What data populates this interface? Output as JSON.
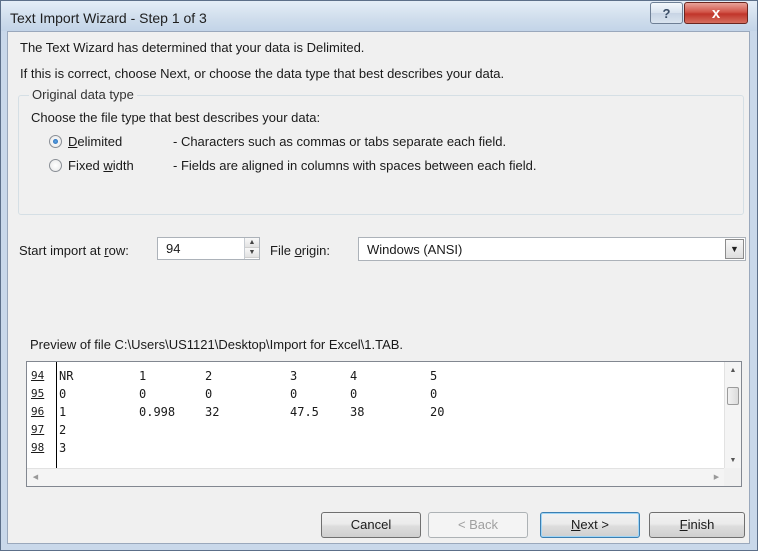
{
  "window": {
    "title": "Text Import Wizard - Step 1 of 3",
    "help_glyph": "?",
    "close_glyph": "x"
  },
  "intro": {
    "line1": "The Text Wizard has determined that your data is Delimited.",
    "line2": "If this is correct, choose Next, or choose the data type that best describes your data."
  },
  "original_data_type": {
    "legend": "Original data type",
    "prompt": "Choose the file type that best describes your data:",
    "options": [
      {
        "label_pre": "",
        "label_key": "D",
        "label_post": "elimited",
        "description": "- Characters such as commas or tabs separate each field.",
        "selected": true
      },
      {
        "label_pre": "Fixed ",
        "label_key": "w",
        "label_post": "idth",
        "description": "- Fields are aligned in columns with spaces between each field.",
        "selected": false
      }
    ]
  },
  "start_row": {
    "label_pre": "Start import at ",
    "label_key": "r",
    "label_post": "ow:",
    "value": "94"
  },
  "file_origin": {
    "label_pre": "File ",
    "label_key": "o",
    "label_post": "rigin:",
    "value": "Windows (ANSI)"
  },
  "preview": {
    "label": "Preview of file C:\\Users\\US1121\\Desktop\\Import for Excel\\1.TAB.",
    "rows": [
      {
        "num": "94",
        "cells": [
          "NR",
          "1",
          "2",
          "3",
          "4",
          "5"
        ]
      },
      {
        "num": "95",
        "cells": [
          "0",
          "0",
          "0",
          "0",
          "0",
          "0"
        ]
      },
      {
        "num": "96",
        "cells": [
          "1",
          "0.998",
          "32",
          "47.5",
          "38",
          "20"
        ]
      },
      {
        "num": "97",
        "cells": [
          "2",
          "",
          "",
          "",
          "",
          ""
        ]
      },
      {
        "num": "98",
        "cells": [
          "3",
          "",
          "",
          "",
          "",
          ""
        ]
      }
    ]
  },
  "buttons": {
    "cancel": "Cancel",
    "back": "< Back",
    "next_key": "N",
    "next_rest": "ext >",
    "finish_key": "F",
    "finish_rest": "inish"
  }
}
